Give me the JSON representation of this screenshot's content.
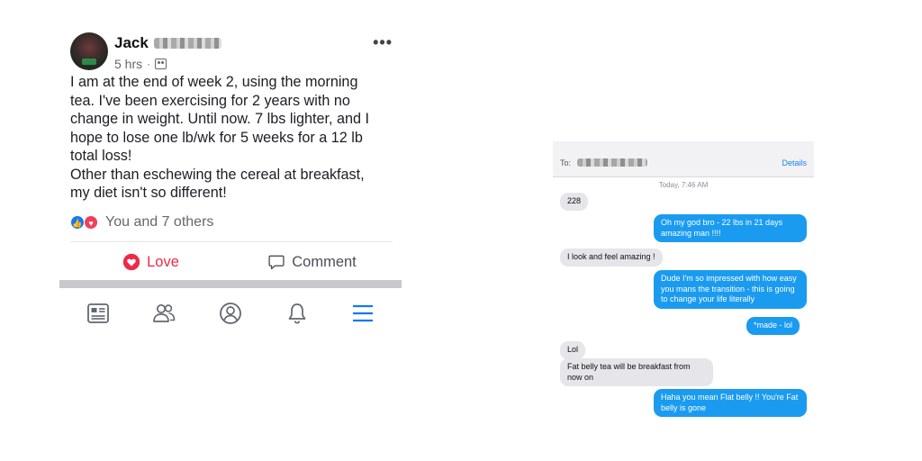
{
  "facebook_post": {
    "author_name": "Jack",
    "timestamp": "5 hrs",
    "audience_icon": "friends-icon",
    "more_label": "•••",
    "body_lines": [
      "I am at the end of week 2, using the morning",
      "tea. I've been exercising for 2 years with no",
      "change in weight. Until now. 7 lbs lighter, and I",
      "hope to lose one lb/wk for 5 weeks for a 12 lb",
      "total loss!",
      "Other than eschewing the cereal at breakfast,",
      "my diet isn't so different!"
    ],
    "reactions_text": "You and 7 others",
    "actions": {
      "love_label": "Love",
      "comment_label": "Comment"
    },
    "colors": {
      "love": "#f02849",
      "like": "#1877f2",
      "tab_active": "#1877f2"
    },
    "tabs": [
      "news-feed-icon",
      "friends-icon",
      "profile-icon",
      "notifications-icon",
      "menu-icon"
    ]
  },
  "imessage": {
    "to_label": "To:",
    "details_label": "Details",
    "timestamp": "Today, 7:46 AM",
    "messages": [
      {
        "dir": "in",
        "text": "228"
      },
      {
        "dir": "out",
        "text": "Oh my god bro - 22 lbs in 21 days amazing man !!!!"
      },
      {
        "dir": "in",
        "text": "I look and feel amazing !"
      },
      {
        "dir": "out",
        "text": "Dude I'm so impressed with how easy you mans the transition - this is going to change your life literally"
      },
      {
        "dir": "out",
        "text": "*made - lol"
      },
      {
        "dir": "in",
        "text": "Lol"
      },
      {
        "dir": "in",
        "text": "Fat belly tea will be breakfast from now on"
      },
      {
        "dir": "out",
        "text": "Haha you mean Flat belly !! You're Fat belly is gone"
      }
    ],
    "colors": {
      "incoming": "#e5e5ea",
      "outgoing": "#1a9bf0",
      "link": "#1a7ff2"
    }
  }
}
